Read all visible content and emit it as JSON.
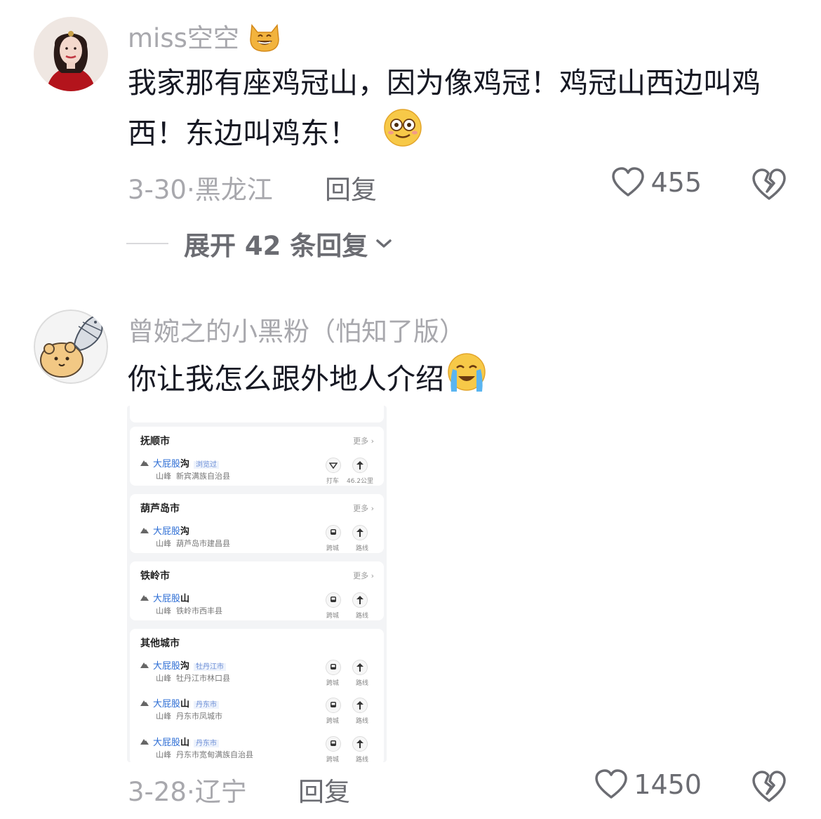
{
  "comments": [
    {
      "username": "miss空空",
      "username_emoji": "cat-grin-emoji",
      "text": "我家那有座鸡冠山，因为像鸡冠！鸡冠山西边叫鸡西！东边叫鸡东！",
      "text_emoji": "dazed-smile-emoji",
      "date": "3-30",
      "location": "黑龙江",
      "reply_label": "回复",
      "likes": "455",
      "expand_label": "展开 42 条回复"
    },
    {
      "username": "曾婉之的小黑粉（怕知了版）",
      "text": "你让我怎么跟外地人介绍",
      "text_emoji": "crying-laugh-emoji",
      "date": "3-28",
      "location": "辽宁",
      "reply_label": "回复",
      "likes": "1450"
    }
  ],
  "embedded_map": {
    "more_label": "更多",
    "groups": [
      {
        "city": "抚顺市",
        "show_more": true,
        "places": [
          {
            "name_hl": "大屁股",
            "name_rest": "沟",
            "tag": "浏览过",
            "type": "山峰",
            "region": "新宾满族自治县",
            "actions": [
              "打车",
              "46.2公里"
            ]
          }
        ]
      },
      {
        "city": "葫芦岛市",
        "show_more": true,
        "places": [
          {
            "name_hl": "大屁股",
            "name_rest": "沟",
            "tag": "",
            "type": "山峰",
            "region": "葫芦岛市建昌县",
            "actions": [
              "跨城",
              "路线"
            ]
          }
        ]
      },
      {
        "city": "铁岭市",
        "show_more": true,
        "places": [
          {
            "name_hl": "大屁股",
            "name_rest": "山",
            "tag": "",
            "type": "山峰",
            "region": "铁岭市西丰县",
            "actions": [
              "跨城",
              "路线"
            ]
          }
        ]
      },
      {
        "city": "其他城市",
        "show_more": false,
        "places": [
          {
            "name_hl": "大屁股",
            "name_rest": "沟",
            "tag": "牡丹江市",
            "type": "山峰",
            "region": "牡丹江市林口县",
            "actions": [
              "跨城",
              "路线"
            ]
          },
          {
            "name_hl": "大屁股",
            "name_rest": "山",
            "tag": "丹东市",
            "type": "山峰",
            "region": "丹东市凤城市",
            "actions": [
              "跨城",
              "路线"
            ]
          },
          {
            "name_hl": "大屁股",
            "name_rest": "山",
            "tag": "丹东市",
            "type": "山峰",
            "region": "丹东市宽甸满族自治县",
            "actions": [
              "跨城",
              "路线"
            ]
          }
        ]
      }
    ]
  },
  "colors": {
    "text": "#161823",
    "muted": "#a8a8ad",
    "action": "#6b6c72",
    "link": "#2b6cd4"
  }
}
